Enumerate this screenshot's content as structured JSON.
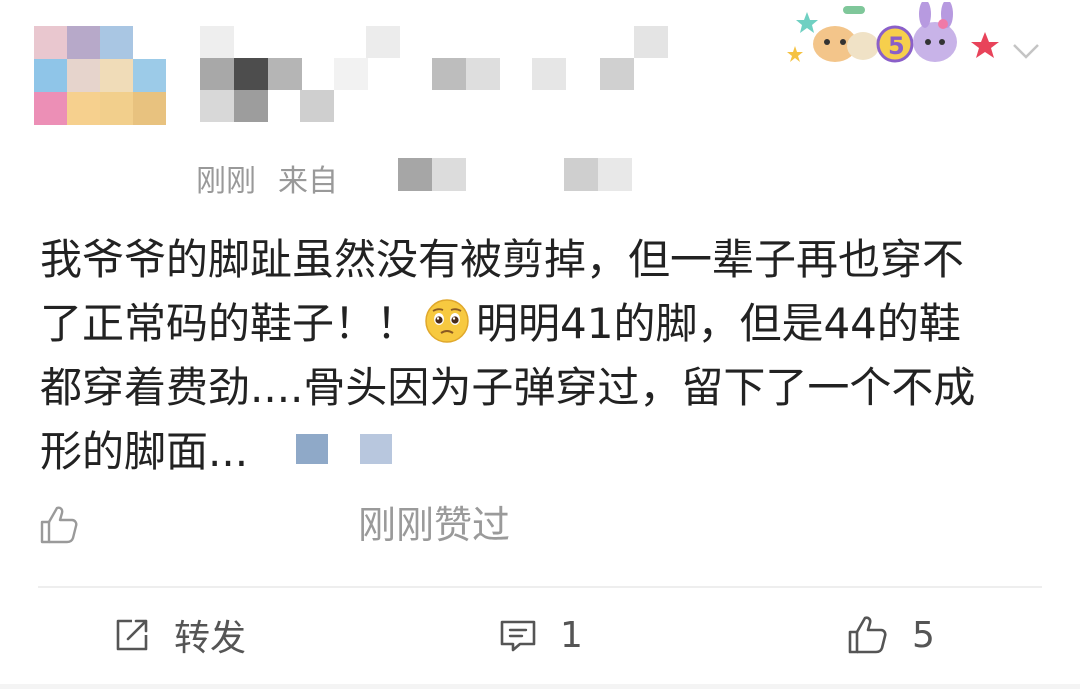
{
  "post": {
    "timestamp": "刚刚",
    "source_prefix": "来自",
    "content_lines": [
      "我爷爷的脚趾虽然没有被剪掉，但一辈子再也穿不",
      "了正常码的鞋子！！",
      "明明41的脚，但是44的鞋",
      "都穿着费劲....骨头因为子弹穿过，留下了一个不成",
      "形的脚面..."
    ],
    "liked_status": "刚刚赞过"
  },
  "actions": {
    "share_label": "转发",
    "comment_count": "1",
    "like_count": "5"
  },
  "icons": {
    "emoji": "pleading-face-icon",
    "liked": "thumbs-up-outline-icon",
    "share": "share-arrow-icon",
    "comment": "comment-bubble-icon",
    "like": "thumbs-up-icon",
    "menu": "chevron-down-icon"
  },
  "colors": {
    "text": "#222222",
    "meta": "#999999",
    "action": "#555555"
  }
}
